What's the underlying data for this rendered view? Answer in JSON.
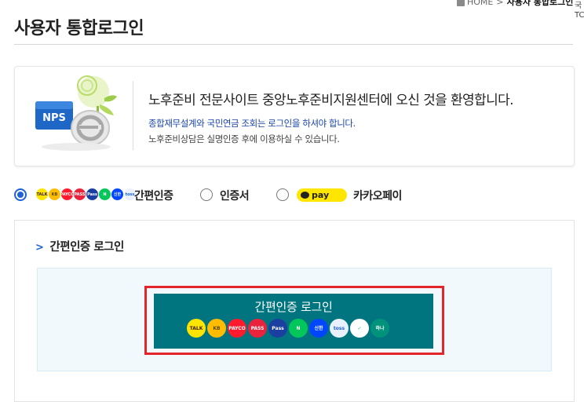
{
  "breadcrumb": {
    "home": "HOME",
    "separator": ">",
    "current": "사용자 통합로그인"
  },
  "side_fragment": {
    "line1": "국",
    "line2": "TC"
  },
  "page": {
    "title": "사용자 통합로그인"
  },
  "welcome": {
    "logo_text": "NPS",
    "heading": "노후준비 전문사이트 중앙노후준비지원센터에 오신 것을 환영합니다.",
    "sub_line1": "종합재무설계와 국민연금 조회는 로그인을 하셔야 합니다.",
    "sub_line2": "노후준비상담은 실명인증 후에 이용하실 수 있습니다."
  },
  "login_methods": {
    "selected": "easy",
    "easy_label": "간편인증",
    "cert_label": "인증서",
    "kakao_label": "카카오페이",
    "kakao_pay_text": "pay"
  },
  "easy_login": {
    "section_title": "간편인증 로그인",
    "button_label": "간편인증 로그인"
  },
  "provider_icons": [
    {
      "name": "kakao-talk-icon",
      "text": "TALK",
      "color": "#fee500",
      "fg": "#3c1e1e"
    },
    {
      "name": "kb-icon",
      "text": "KB",
      "color": "#ffbc00",
      "fg": "#5a4a00"
    },
    {
      "name": "payco-icon",
      "text": "PAYCO",
      "color": "#ff1b2d",
      "fg": "#ffffff"
    },
    {
      "name": "pass-icon",
      "text": "PASS",
      "color": "#e8233b",
      "fg": "#ffffff"
    },
    {
      "name": "samsung-pass-icon",
      "text": "Pass",
      "color": "#1a3fa0",
      "fg": "#ffffff"
    },
    {
      "name": "naver-icon",
      "text": "N",
      "color": "#03c75a",
      "fg": "#ffffff"
    },
    {
      "name": "shinhan-icon",
      "text": "신한",
      "color": "#0046ff",
      "fg": "#ffffff"
    },
    {
      "name": "toss-icon",
      "text": "toss",
      "color": "#e9f1ff",
      "fg": "#1b64da"
    },
    {
      "name": "banksalad-icon",
      "text": "✓",
      "color": "#ffffff",
      "fg": "#04c584"
    },
    {
      "name": "hana-icon",
      "text": "하나",
      "color": "#00927a",
      "fg": "#ffffff"
    }
  ],
  "colors": {
    "accent_blue": "#1f63d3",
    "button_teal": "#00747f",
    "highlight_red": "#e3242b"
  }
}
